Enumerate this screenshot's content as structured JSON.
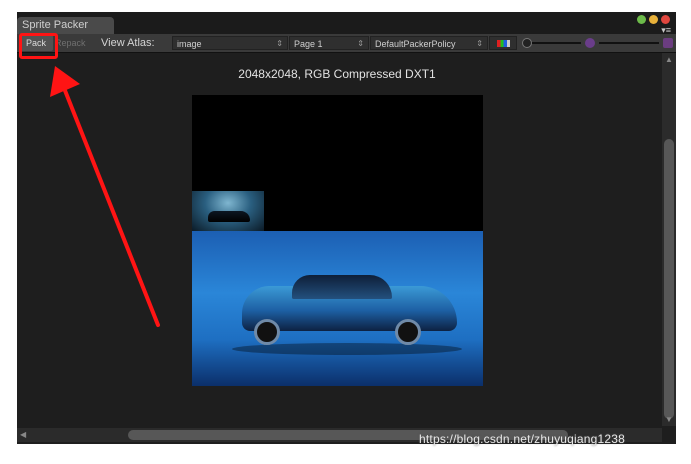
{
  "window": {
    "tab_title": "Sprite Packer"
  },
  "toolbar": {
    "pack_label": "Pack",
    "repack_label": "Repack",
    "view_atlas_label": "View Atlas:",
    "atlas_value": "image",
    "page_value": "Page 1",
    "policy_value": "DefaultPackerPolicy",
    "dropdown_arrow": "⇕"
  },
  "atlas": {
    "caption": "2048x2048, RGB Compressed DXT1"
  },
  "watermark": {
    "text": "https://blog.csdn.net/zhuyuqiang1238"
  },
  "colors": {
    "annotation": "#ff1414",
    "background": "#1e1e1e",
    "toolbar": "#3a3a3a"
  }
}
